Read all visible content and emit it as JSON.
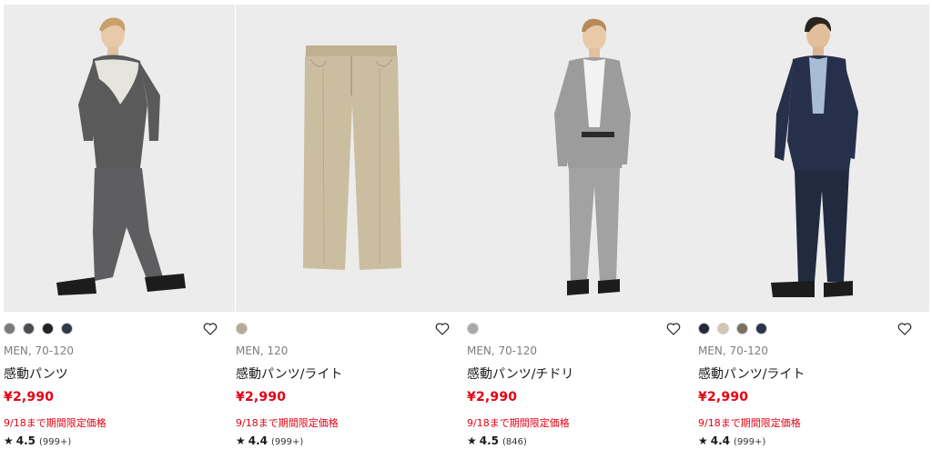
{
  "colors": {
    "price": "#e60012",
    "promo": "#e60012",
    "photo_bg": "#ececec"
  },
  "products": [
    {
      "swatches": [
        "#7a7a7a",
        "#4a4d52",
        "#1f2226",
        "#2e3a4c"
      ],
      "gender": "MEN, 70-120",
      "name": "感動パンツ",
      "price": "¥2,990",
      "promo": "9/18まで期間限定価格",
      "star": "★",
      "rating": "4.5",
      "reviews": "(999+)"
    },
    {
      "swatches": [
        "#b8aa94"
      ],
      "gender": "MEN, 120",
      "name": "感動パンツ/ライト",
      "price": "¥2,990",
      "promo": "9/18まで期間限定価格",
      "star": "★",
      "rating": "4.4",
      "reviews": "(999+)"
    },
    {
      "swatches": [
        "#a9a9a9"
      ],
      "gender": "MEN, 70-120",
      "name": "感動パンツ/チドリ",
      "price": "¥2,990",
      "promo": "9/18まで期間限定価格",
      "star": "★",
      "rating": "4.5",
      "reviews": "(846)"
    },
    {
      "swatches": [
        "#232a3a",
        "#d3c6b2",
        "#7d6e5e",
        "#2b344a"
      ],
      "gender": "MEN, 70-120",
      "name": "感動パンツ/ライト",
      "price": "¥2,990",
      "promo": "9/18まで期間限定価格",
      "star": "★",
      "rating": "4.4",
      "reviews": "(999+)"
    }
  ],
  "icons": {
    "favorite": "heart-outline-icon",
    "rating": "star-icon"
  }
}
